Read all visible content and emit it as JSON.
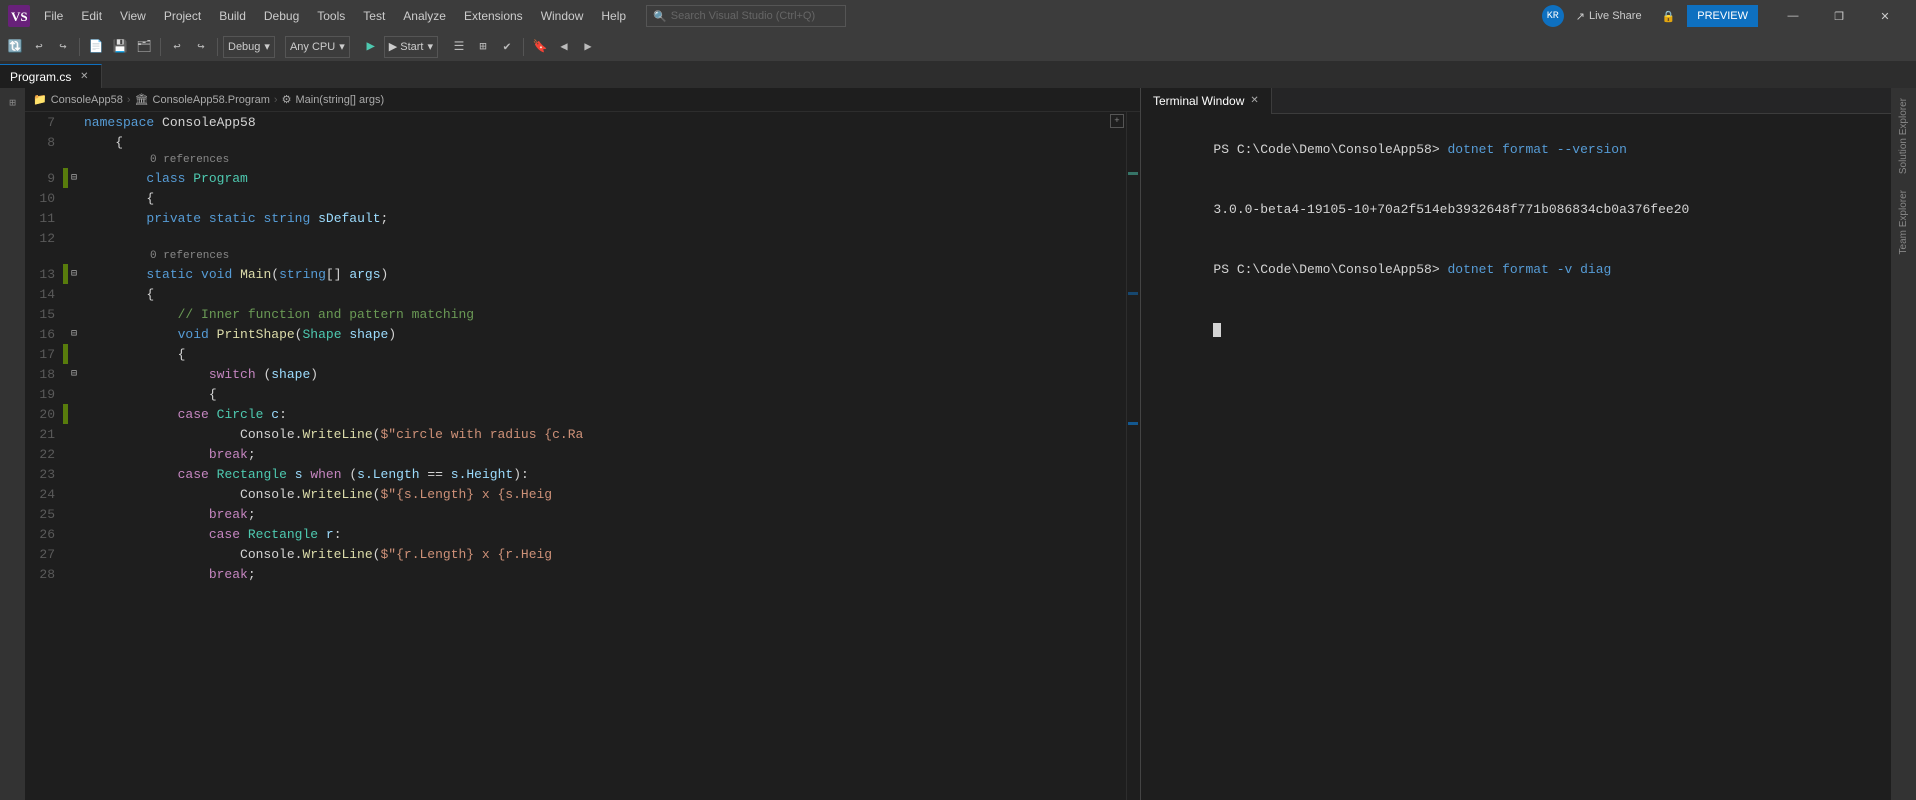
{
  "titlebar": {
    "menus": [
      "File",
      "Edit",
      "View",
      "Project",
      "Build",
      "Debug",
      "Tools",
      "Test",
      "Analyze",
      "Extensions",
      "Window",
      "Help"
    ],
    "search_placeholder": "Search Visual Studio (Ctrl+Q)",
    "window_buttons": [
      "—",
      "❐",
      "✕"
    ]
  },
  "toolbar": {
    "debug_config": "Debug",
    "platform": "Any CPU",
    "start_label": "▶ Start",
    "live_share": "Live Share",
    "preview_label": "PREVIEW"
  },
  "editor_tab": {
    "filename": "Program.cs",
    "is_active": true
  },
  "breadcrumb": {
    "project": "ConsoleApp58",
    "class": "ConsoleApp58.Program",
    "method": "Main(string[] args)"
  },
  "code_lines": [
    {
      "num": 7,
      "gutter": "empty",
      "fold": false,
      "text": "namespace ConsoleApp58",
      "tokens": [
        {
          "t": "kw",
          "v": "namespace"
        },
        {
          "t": "ns",
          "v": " ConsoleApp58"
        }
      ]
    },
    {
      "num": 8,
      "gutter": "empty",
      "fold": false,
      "text": "    {",
      "tokens": [
        {
          "t": "punc",
          "v": "    {"
        }
      ]
    },
    {
      "num": 9,
      "gutter": "green",
      "fold": true,
      "text": "        0 references",
      "hint": true,
      "code": "        class Program",
      "tokens": [
        {
          "t": "ref",
          "v": "        0 references"
        },
        {
          "t": "kw",
          "v": "class"
        },
        {
          "t": "type",
          "v": " Program"
        }
      ]
    },
    {
      "num": 10,
      "gutter": "empty",
      "fold": false,
      "text": "        {",
      "tokens": [
        {
          "t": "punc",
          "v": "        {"
        }
      ]
    },
    {
      "num": 11,
      "gutter": "empty",
      "fold": false,
      "text": "        private static string sDefault;",
      "tokens": [
        {
          "t": "kw",
          "v": "        private"
        },
        {
          "t": "kw",
          "v": " static"
        },
        {
          "t": "kw",
          "v": " string"
        },
        {
          "t": "var",
          "v": " sDefault"
        },
        {
          "t": "punc",
          "v": ";"
        }
      ]
    },
    {
      "num": 12,
      "gutter": "empty",
      "fold": false,
      "text": "",
      "tokens": []
    },
    {
      "num": 13,
      "gutter": "green",
      "fold": true,
      "text": "        0 references",
      "hint": true,
      "code": "        static void Main(string[] args)",
      "tokens": [
        {
          "t": "ref",
          "v": "        0 references"
        },
        {
          "t": "kw",
          "v": "static"
        },
        {
          "t": "kw",
          "v": " void"
        },
        {
          "t": "method",
          "v": " Main"
        },
        {
          "t": "punc",
          "v": "("
        },
        {
          "t": "kw",
          "v": "string"
        },
        {
          "t": "punc",
          "v": "[]"
        },
        {
          "t": "var",
          "v": " args"
        },
        {
          "t": "punc",
          "v": ")"
        }
      ]
    },
    {
      "num": 14,
      "gutter": "empty",
      "fold": false,
      "text": "        {",
      "tokens": [
        {
          "t": "punc",
          "v": "        {"
        }
      ]
    },
    {
      "num": 15,
      "gutter": "empty",
      "fold": false,
      "text": "            // Inner function and pattern matching",
      "tokens": [
        {
          "t": "comment",
          "v": "            // Inner function and pattern matching"
        }
      ]
    },
    {
      "num": 16,
      "gutter": "empty",
      "fold": true,
      "text": "            void PrintShape(Shape shape)",
      "tokens": [
        {
          "t": "kw",
          "v": "            void"
        },
        {
          "t": "method",
          "v": " PrintShape"
        },
        {
          "t": "punc",
          "v": "("
        },
        {
          "t": "type",
          "v": "Shape"
        },
        {
          "t": "var",
          "v": " shape"
        },
        {
          "t": "punc",
          "v": ")"
        }
      ]
    },
    {
      "num": 17,
      "gutter": "green",
      "fold": false,
      "text": "            {",
      "tokens": [
        {
          "t": "punc",
          "v": "            {"
        }
      ]
    },
    {
      "num": 18,
      "gutter": "empty",
      "fold": true,
      "text": "                switch (shape)",
      "tokens": [
        {
          "t": "kw2",
          "v": "                switch"
        },
        {
          "t": "punc",
          "v": " ("
        },
        {
          "t": "var",
          "v": "shape"
        },
        {
          "t": "punc",
          "v": ")"
        }
      ]
    },
    {
      "num": 19,
      "gutter": "empty",
      "fold": false,
      "text": "                {",
      "tokens": [
        {
          "t": "punc",
          "v": "                {"
        }
      ]
    },
    {
      "num": 20,
      "gutter": "green",
      "fold": false,
      "text": "            case Circle c:",
      "tokens": [
        {
          "t": "kw2",
          "v": "            case"
        },
        {
          "t": "type",
          "v": " Circle"
        },
        {
          "t": "var",
          "v": " c"
        },
        {
          "t": "punc",
          "v": ":"
        }
      ]
    },
    {
      "num": 21,
      "gutter": "empty",
      "fold": false,
      "text": "                    Console.WriteLine($\"circle with radius {c.Ra",
      "tokens": [
        {
          "t": "ns",
          "v": "                    Console"
        },
        {
          "t": "punc",
          "v": "."
        },
        {
          "t": "method",
          "v": "WriteLine"
        },
        {
          "t": "punc",
          "v": "("
        },
        {
          "t": "string",
          "v": "$\"circle with radius {c.Ra"
        }
      ]
    },
    {
      "num": 22,
      "gutter": "empty",
      "fold": false,
      "text": "                break;",
      "tokens": [
        {
          "t": "kw2",
          "v": "                break"
        },
        {
          "t": "punc",
          "v": ";"
        }
      ]
    },
    {
      "num": 23,
      "gutter": "empty",
      "fold": false,
      "text": "            case Rectangle s when (s.Length == s.Height):",
      "tokens": [
        {
          "t": "kw2",
          "v": "            case"
        },
        {
          "t": "type",
          "v": " Rectangle"
        },
        {
          "t": "var",
          "v": " s"
        },
        {
          "t": "kw2",
          "v": " when"
        },
        {
          "t": "punc",
          "v": " ("
        },
        {
          "t": "var",
          "v": "s.Length"
        },
        {
          "t": "punc",
          "v": " =="
        },
        {
          "t": "var",
          "v": " s.Height"
        },
        {
          "t": "punc",
          "v": "):"
        }
      ]
    },
    {
      "num": 24,
      "gutter": "empty",
      "fold": false,
      "text": "                    Console.WriteLine($\"{s.Length} x {s.Heig",
      "tokens": [
        {
          "t": "ns",
          "v": "                    Console"
        },
        {
          "t": "punc",
          "v": "."
        },
        {
          "t": "method",
          "v": "WriteLine"
        },
        {
          "t": "punc",
          "v": "("
        },
        {
          "t": "string",
          "v": "$\"{s.Length} x {s.Heig"
        }
      ]
    },
    {
      "num": 25,
      "gutter": "empty",
      "fold": false,
      "text": "                break;",
      "tokens": [
        {
          "t": "kw2",
          "v": "                break"
        },
        {
          "t": "punc",
          "v": ";"
        }
      ]
    },
    {
      "num": 26,
      "gutter": "empty",
      "fold": false,
      "text": "                case Rectangle r:",
      "tokens": [
        {
          "t": "kw2",
          "v": "                case"
        },
        {
          "t": "type",
          "v": " Rectangle"
        },
        {
          "t": "var",
          "v": " r"
        },
        {
          "t": "punc",
          "v": ":"
        }
      ]
    },
    {
      "num": 27,
      "gutter": "empty",
      "fold": false,
      "text": "                    Console.WriteLine($\"{r.Length} x {r.Heig",
      "tokens": [
        {
          "t": "ns",
          "v": "                    Console"
        },
        {
          "t": "punc",
          "v": "."
        },
        {
          "t": "method",
          "v": "WriteLine"
        },
        {
          "t": "punc",
          "v": "("
        },
        {
          "t": "string",
          "v": "$\"{r.Length} x {r.Heig"
        }
      ]
    },
    {
      "num": 28,
      "gutter": "empty",
      "fold": false,
      "text": "                break;",
      "tokens": [
        {
          "t": "kw2",
          "v": "                break"
        },
        {
          "t": "punc",
          "v": ";"
        }
      ]
    }
  ],
  "terminal": {
    "tab_label": "Terminal Window",
    "lines": [
      {
        "type": "prompt",
        "prompt": "PS C:\\Code\\Demo\\ConsoleApp58>",
        "cmd": " dotnet format --version"
      },
      {
        "type": "output",
        "text": "3.0.0-beta4-19105-10+70a2f514eb3932648f771b086834cb0a376fee20"
      },
      {
        "type": "prompt",
        "prompt": "PS C:\\Code\\Demo\\ConsoleApp58>",
        "cmd": " dotnet format -v diag"
      }
    ]
  },
  "right_panels": {
    "team_explorer": "Team Explorer",
    "solution_explorer": "Solution Explorer"
  },
  "colors": {
    "keyword": "#569cd6",
    "keyword2": "#c586c0",
    "type": "#4ec9b0",
    "string": "#ce9178",
    "comment": "#6a9955",
    "method": "#dcdcaa",
    "variable": "#9cdcfe",
    "accent": "#0e70c0"
  }
}
